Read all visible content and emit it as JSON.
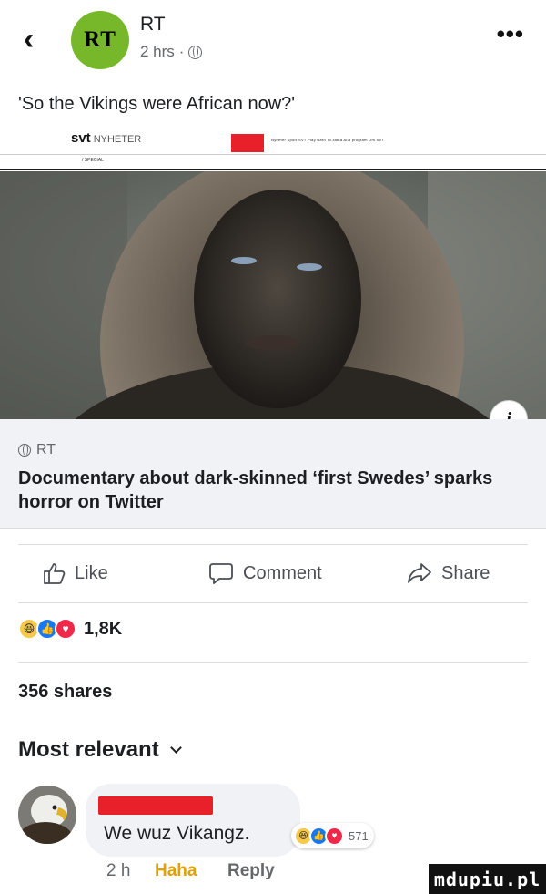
{
  "header": {
    "page_avatar_text": "RT",
    "page_name": "RT",
    "time": "2 hrs",
    "visibility_icon": "globe-icon"
  },
  "post": {
    "text": "'So the Vikings were African now?'"
  },
  "link_preview": {
    "svt_logo": "svt",
    "svt_section": "NYHETER",
    "svt_nav": "Nyheter   Sport   SVT Play   Barn   Tv-tablå   Alla program   Om SVT",
    "svt_special": "/ SPECIAL",
    "source": "RT",
    "headline": "Documentary about dark-skinned ‘first Swedes’ sparks horror on Twitter",
    "info_icon_text": "i"
  },
  "actions": {
    "like": "Like",
    "comment": "Comment",
    "share": "Share"
  },
  "reactions": {
    "types": [
      "haha",
      "like",
      "love"
    ],
    "count": "1,8K"
  },
  "shares": "356 shares",
  "comments_filter": "Most relevant",
  "comment": {
    "text": "We wuz Vikangz.",
    "reaction_count": "571",
    "time": "2 h",
    "reaction_label": "Haha",
    "reply_label": "Reply"
  },
  "watermark": "mdupiu.pl",
  "colors": {
    "rt_green": "#77b82a",
    "facebook_blue": "#1877f2",
    "love_red": "#f0284a",
    "haha_yellow": "#f7c94b",
    "svt_red": "#e8202a"
  }
}
